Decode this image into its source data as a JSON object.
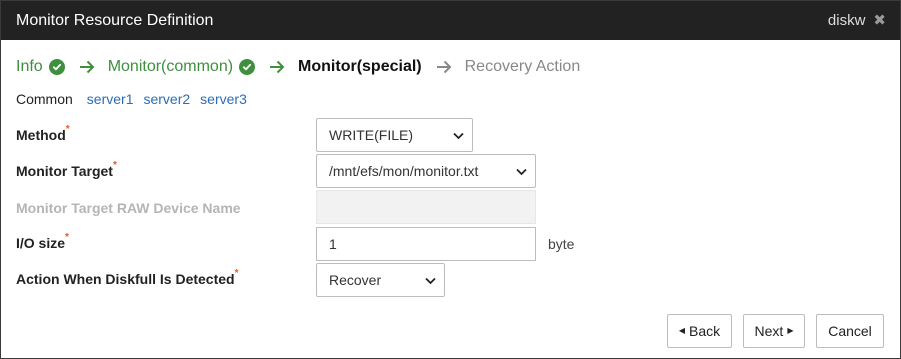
{
  "dialog": {
    "title": "Monitor Resource Definition",
    "resource_name": "diskw",
    "close_icon": "close-icon"
  },
  "steps": [
    {
      "label": "Info",
      "state": "done"
    },
    {
      "label": "Monitor(common)",
      "state": "done"
    },
    {
      "label": "Monitor(special)",
      "state": "current"
    },
    {
      "label": "Recovery Action",
      "state": "future"
    }
  ],
  "server_tabs": {
    "common": "Common",
    "servers": [
      "server1",
      "server2",
      "server3"
    ]
  },
  "form": {
    "method": {
      "label": "Method",
      "required": "*",
      "value": "WRITE(FILE)"
    },
    "monitor_target": {
      "label": "Monitor Target",
      "required": "*",
      "value": "/mnt/efs/mon/monitor.txt"
    },
    "raw_device": {
      "label": "Monitor Target RAW Device Name",
      "value": ""
    },
    "io_size": {
      "label": "I/O size",
      "required": "*",
      "value": "1",
      "unit": "byte"
    },
    "diskfull_action": {
      "label": "Action When Diskfull Is Detected",
      "required": "*",
      "value": "Recover"
    }
  },
  "buttons": {
    "back": "Back",
    "next": "Next",
    "cancel": "Cancel"
  },
  "colors": {
    "titlebar": "#222222",
    "step_done": "#3f8f3f",
    "link": "#2a6eb5",
    "required": "#e05a2b"
  }
}
